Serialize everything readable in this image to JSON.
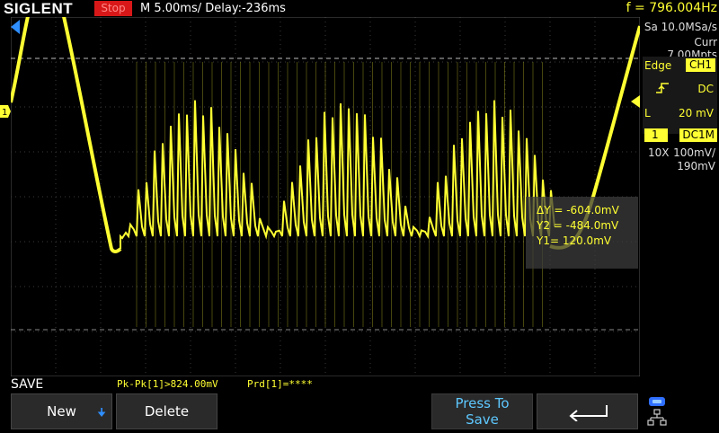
{
  "header": {
    "brand": "SIGLENT",
    "run_state": "Stop",
    "timebase": "M 5.00ms/ Delay:-236ms",
    "frequency": "f = 796.004Hz"
  },
  "acquisition": {
    "sample_rate": "Sa 10.0MSa/s",
    "memory": "Curr 7.00Mpts"
  },
  "trigger": {
    "type": "Edge",
    "source": "CH1",
    "slope_icon": "rising-edge-icon",
    "coupling": "DC",
    "level_label": "L",
    "level": "20 mV"
  },
  "channel1": {
    "number": "1",
    "coupling": "DC1M",
    "probe": "10X",
    "scale": "100mV/",
    "offset": "190mV"
  },
  "cursor_readout": {
    "delta_y": "ΔY = -604.0mV",
    "y2": "Y2 = -484.0mV",
    "y1": "Y1= 120.0mV"
  },
  "menu": {
    "title": "SAVE",
    "new_label": "New",
    "delete_label": "Delete",
    "press_line1": "Press To",
    "press_line2": "Save"
  },
  "measurements": {
    "pkpk": "Pk-Pk[1]>824.00mV",
    "prd": "Prd[1]=****"
  },
  "colors": {
    "trace": "#ffff33",
    "stop_badge": "#d81818",
    "softkey_highlight": "#5ec8ff"
  }
}
